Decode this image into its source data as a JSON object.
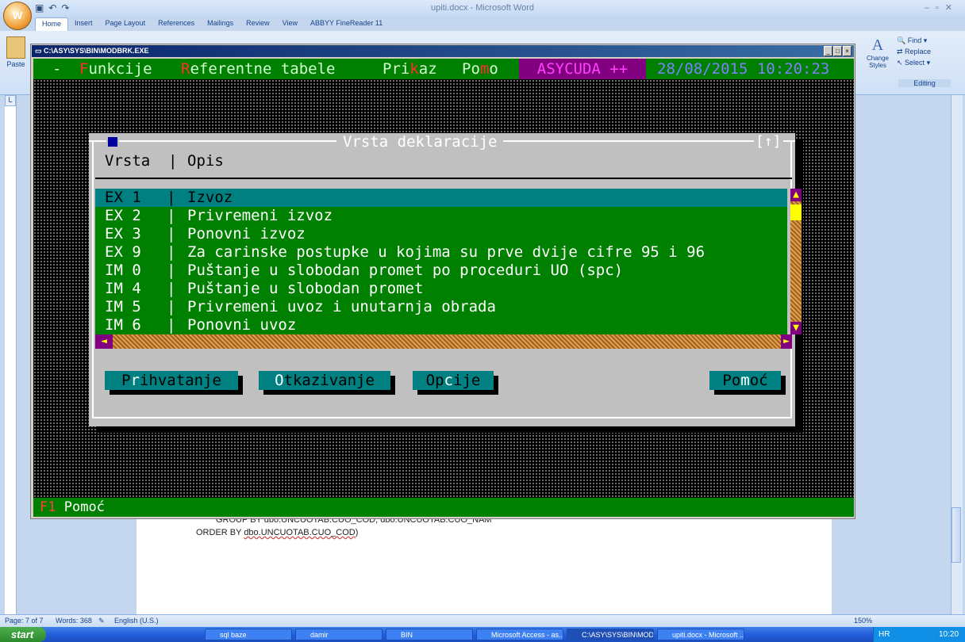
{
  "word": {
    "title": "upiti.docx - Microsoft Word",
    "office_button": "W",
    "ribbon_tabs": [
      "Home",
      "Insert",
      "Page Layout",
      "References",
      "Mailings",
      "Review",
      "View",
      "ABBYY FineReader 11"
    ],
    "paste_label": "Paste",
    "change_styles_label": "Change Styles",
    "find_label": "Find",
    "replace_label": "Replace",
    "select_label": "Select",
    "editing_label": "Editing",
    "doc_line1": "GROUP BY dbo.UNCUOTAB.CUO_COD, dbo.UNCUOTAB.CUO_NAM",
    "doc_line2_prefix": "ORDER BY ",
    "doc_line2_link": "dbo.UNCUOTAB.CUO_COD",
    "doc_line2_suffix": ")",
    "status": {
      "page": "Page: 7 of 7",
      "words": "Words: 368",
      "language": "English (U.S.)",
      "zoom": "150%"
    }
  },
  "console": {
    "title": "C:\\ASY\\SYS\\BIN\\MODBRK.EXE",
    "menu_dash": "-",
    "menu_items": [
      {
        "hot": "F",
        "rest": "unkcije"
      },
      {
        "hot": "R",
        "rest": "eferentne tabele"
      },
      {
        "pre": "Pri",
        "hot": "k",
        "rest": "az"
      },
      {
        "pre": "Po",
        "hot": "m",
        "rest": "o"
      }
    ],
    "app_badge": "ASYCUDA ++",
    "datetime": "28/08/2015 10:20:23",
    "status_key": "F1",
    "status_text": "Pomoć"
  },
  "dialog": {
    "title": "Vrsta deklaracije",
    "close_glyph": "[",
    "close_glyph_end": "]",
    "resize_glyph": "[↑]",
    "col_code": "Vrsta",
    "col_sep": "|",
    "col_desc": "Opis",
    "rows": [
      {
        "code": "EX 1",
        "desc": "Izvoz"
      },
      {
        "code": "EX 2",
        "desc": "Privremeni izvoz"
      },
      {
        "code": "EX 3",
        "desc": "Ponovni izvoz"
      },
      {
        "code": "EX 9",
        "desc": "Za carinske postupke u kojima su prve dvije cifre 95 i 96"
      },
      {
        "code": "IM 0",
        "desc": "Puštanje u slobodan promet po proceduri UO (spc)"
      },
      {
        "code": "IM 4",
        "desc": "Puštanje u slobodan promet"
      },
      {
        "code": "IM 5",
        "desc": "Privremeni uvoz i unutarnja obrada"
      },
      {
        "code": "IM 6",
        "desc": "Ponovni uvoz"
      }
    ],
    "row_bar": "|",
    "scroll_up": "▲",
    "scroll_down": "▼",
    "scroll_left": "◄",
    "scroll_right": "►",
    "buttons": {
      "accept": {
        "pre": "P",
        "hk": "r",
        "rest": "ihvatanje"
      },
      "cancel": {
        "pre": "",
        "hk": "O",
        "rest": "tkazivanje"
      },
      "options": {
        "pre": "Op",
        "hk": "c",
        "rest": "ije"
      },
      "help": {
        "pre": "Po",
        "hk": "m",
        "rest": "oć"
      }
    }
  },
  "taskbar": {
    "start": "start",
    "items": [
      "sql baze",
      "damir",
      "BIN",
      "Microsoft Access - as...",
      "C:\\ASY\\SYS\\BIN\\MOD...",
      "upiti.docx - Microsoft ..."
    ],
    "lang": "HR",
    "clock": "10:20"
  }
}
